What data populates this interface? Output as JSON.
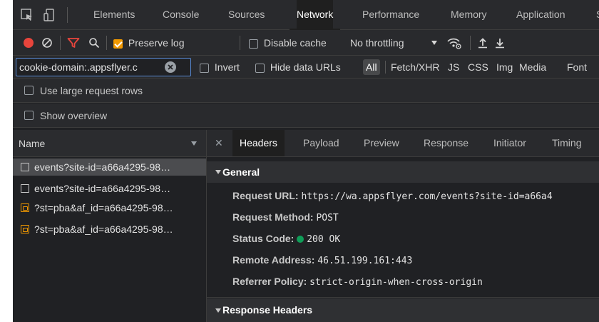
{
  "tabs": [
    "Elements",
    "Console",
    "Sources",
    "Network",
    "Performance",
    "Memory",
    "Application",
    "S"
  ],
  "toolbar": {
    "preserve_log": "Preserve log",
    "disable_cache": "Disable cache",
    "throttling": "No throttling"
  },
  "filter": {
    "value": "cookie-domain:.appsflyer.c",
    "invert": "Invert",
    "hide_data_urls": "Hide data URLs",
    "types": [
      "All",
      "Fetch/XHR",
      "JS",
      "CSS",
      "Img",
      "Media",
      "Font"
    ]
  },
  "options": {
    "large_rows": "Use large request rows",
    "overview": "Show overview"
  },
  "request_list": {
    "column": "Name",
    "items": [
      "events?site-id=a66a4295-98…",
      "events?site-id=a66a4295-98…",
      "?st=pba&af_id=a66a4295-98…",
      "?st=pba&af_id=a66a4295-98…"
    ]
  },
  "details": {
    "tabs": [
      "Headers",
      "Payload",
      "Preview",
      "Response",
      "Initiator",
      "Timing"
    ],
    "general": {
      "title": "General",
      "request_url_label": "Request URL:",
      "request_url": "https://wa.appsflyer.com/events?site-id=a66a4",
      "method_label": "Request Method:",
      "method": "POST",
      "status_label": "Status Code:",
      "status": "200 OK",
      "remote_label": "Remote Address:",
      "remote": "46.51.199.161:443",
      "referrer_label": "Referrer Policy:",
      "referrer": "strict-origin-when-cross-origin"
    },
    "response_headers_title": "Response Headers"
  },
  "colors": {
    "record": "#e8453c",
    "filter_active": "#e8453c",
    "checkbox_on": "#f29900",
    "status_ok": "#0f9d58"
  }
}
